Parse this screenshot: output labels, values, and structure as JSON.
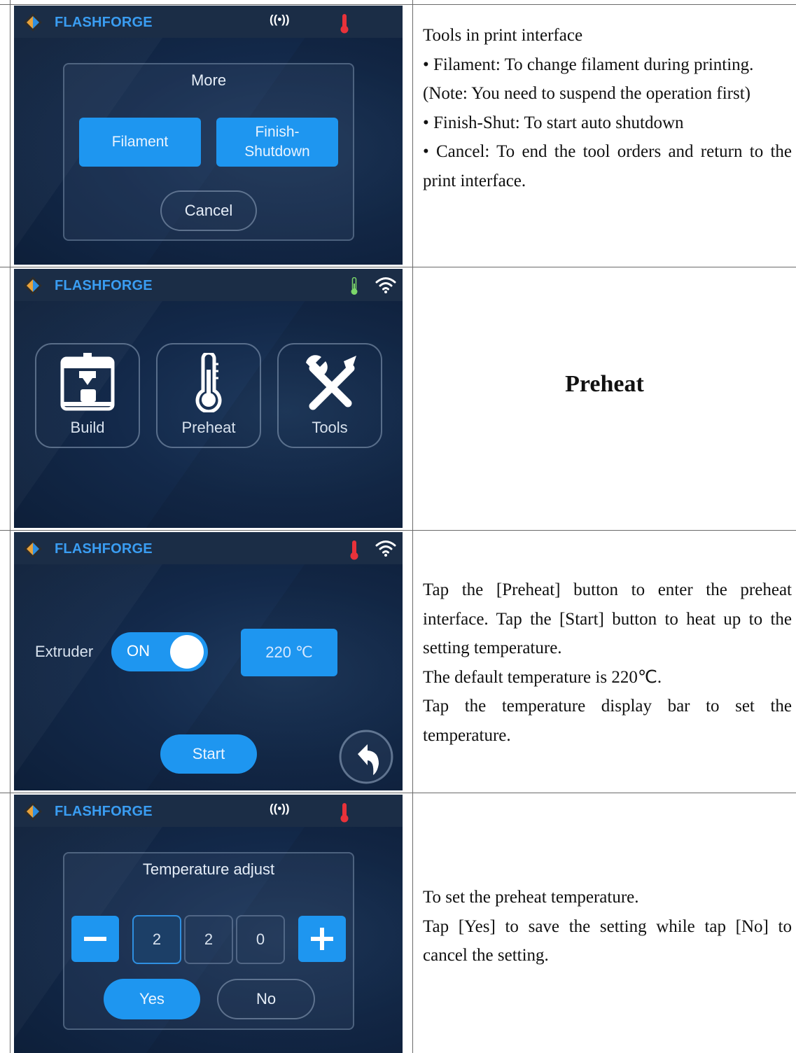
{
  "brand": "FLASHFORGE",
  "rows": [
    {
      "screen": {
        "status_signal": "((•))",
        "thermo_state": "hot",
        "panel_title": "More",
        "buttons": {
          "filament": "Filament",
          "finish_line1": "Finish-",
          "finish_line2": "Shutdown",
          "cancel": "Cancel"
        }
      },
      "description": [
        "Tools in print interface",
        "• Filament: To change filament during printing.",
        "(Note: You need to suspend the operation first)",
        "• Finish-Shut: To start auto shutdown",
        "• Cancel: To end the tool orders and return to the print interface."
      ]
    },
    {
      "screen": {
        "thermo_state": "normal",
        "tiles": [
          "Build",
          "Preheat",
          "Tools"
        ]
      },
      "heading": "Preheat"
    },
    {
      "screen": {
        "thermo_state": "hot",
        "extruder_label": "Extruder",
        "toggle_label": "ON",
        "toggle_on": true,
        "temperature": "220 ℃",
        "start": "Start"
      },
      "description": [
        "Tap the [Preheat] button to enter the preheat interface. Tap the [Start] button to heat up to the setting temperature.",
        "The default temperature is 220℃.",
        "Tap the temperature display bar to set the temperature."
      ]
    },
    {
      "screen": {
        "status_signal": "((•))",
        "thermo_state": "hot",
        "panel_title": "Temperature adjust",
        "digits": [
          "2",
          "2",
          "0"
        ],
        "selected_digit_index": 0,
        "yes": "Yes",
        "no": "No"
      },
      "description": [
        "To set the preheat temperature.",
        "Tap [Yes] to save the setting while tap [No] to cancel the setting."
      ]
    }
  ],
  "colors": {
    "accent": "#1e96f0",
    "brand": "#3a9df2",
    "hot": "#e8323a",
    "normal": "#7bd66a"
  }
}
